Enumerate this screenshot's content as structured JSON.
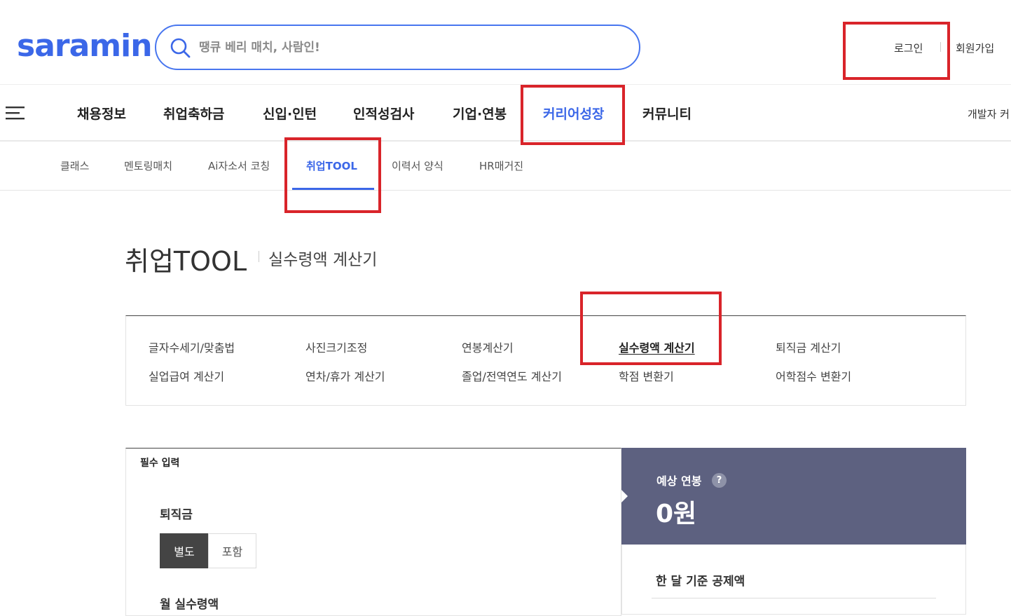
{
  "header": {
    "logo": "saramin",
    "search_placeholder": "땡큐 베리 매치, 사람인!",
    "login": "로그인",
    "signup": "회원가입"
  },
  "gnb": {
    "items": [
      {
        "label": "채용정보"
      },
      {
        "label": "취업축하금"
      },
      {
        "label": "신입·인턴"
      },
      {
        "label": "인적성검사"
      },
      {
        "label": "기업·연봉"
      },
      {
        "label": "커리어성장",
        "active": true
      },
      {
        "label": "커뮤니티"
      }
    ],
    "right_label": "개발자 커"
  },
  "subnav": {
    "items": [
      {
        "label": "클래스"
      },
      {
        "label": "멘토링매치"
      },
      {
        "label": "Ai자소서 코칭"
      },
      {
        "label": "취업TOOL",
        "active": true
      },
      {
        "label": "이력서 양식"
      },
      {
        "label": "HR매거진"
      }
    ]
  },
  "page": {
    "title": "취업TOOL",
    "subtitle": "실수령액 계산기"
  },
  "tools": {
    "items": [
      {
        "label": "글자수세기/맞춤법"
      },
      {
        "label": "사진크기조정"
      },
      {
        "label": "연봉계산기"
      },
      {
        "label": "실수령액 계산기",
        "active": true
      },
      {
        "label": "퇴직금 계산기"
      },
      {
        "label": "실업급여 계산기"
      },
      {
        "label": "연차/휴가 계산기"
      },
      {
        "label": "졸업/전역연도 계산기"
      },
      {
        "label": "학점 변환기"
      },
      {
        "label": "어학점수 변환기"
      }
    ]
  },
  "calculator": {
    "required_label": "필수 입력",
    "severance_label": "퇴직금",
    "separate_label": "별도",
    "include_label": "포함",
    "monthly_label": "월 실수령액",
    "annual_label": "예상 연봉",
    "help_glyph": "?",
    "annual_value": "0원",
    "deduction_label": "한 달 기준 공제액"
  },
  "colors": {
    "brand": "#3b67e8",
    "highlight": "#d9242a",
    "result_panel": "#5d6180"
  }
}
